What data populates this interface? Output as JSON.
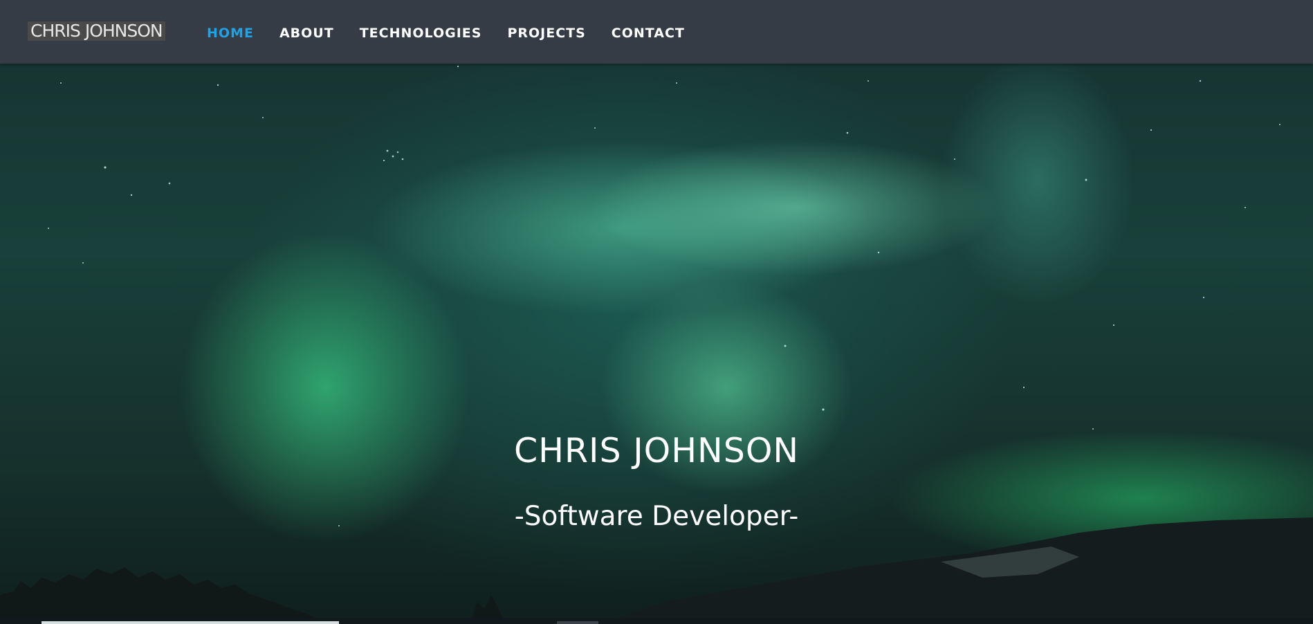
{
  "header": {
    "logo_text": "CHRIS JOHNSON",
    "nav": [
      {
        "label": "HOME",
        "active": true
      },
      {
        "label": "ABOUT",
        "active": false
      },
      {
        "label": "TECHNOLOGIES",
        "active": false
      },
      {
        "label": "PROJECTS",
        "active": false
      },
      {
        "label": "CONTACT",
        "active": false
      }
    ]
  },
  "hero": {
    "title": "CHRIS JOHNSON",
    "subtitle": "-Software Developer-"
  },
  "colors": {
    "navbar_bg": "#353c45",
    "active_nav": "#1fa2e8",
    "text": "#ffffff"
  }
}
